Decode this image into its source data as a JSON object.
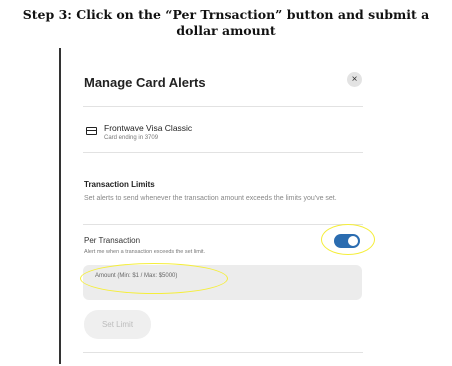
{
  "instruction": {
    "step_text": "Step 3: Click on the “Per Trnsaction” button and submit a dollar amount"
  },
  "modal": {
    "title": "Manage Card Alerts",
    "close_icon": "close-icon",
    "close_glyph": "×"
  },
  "card": {
    "icon": "credit-card-icon",
    "name": "Frontwave Visa Classic",
    "ending": "Card ending in 3709"
  },
  "transaction_limits": {
    "title": "Transaction Limits",
    "description": "Set alerts to send whenever the transaction amount exceeds the limits you've set."
  },
  "per_transaction": {
    "label": "Per Transaction",
    "description": "Alert me when a transaction exceeds the set limit.",
    "enabled": true,
    "toggle_color": "#2b6cb0"
  },
  "amount_field": {
    "placeholder": "Amount (Min: $1 / Max: $5000)",
    "value": ""
  },
  "set_limit": {
    "label": "Set Limit",
    "disabled": true
  },
  "annotation": {
    "highlight_color": "#f5ee3a"
  }
}
